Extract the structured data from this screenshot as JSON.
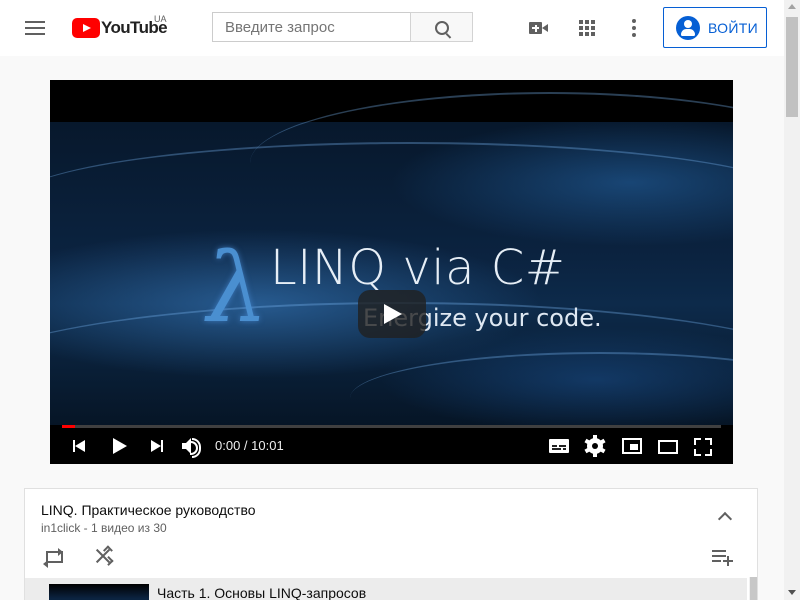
{
  "header": {
    "logo_text": "YouTube",
    "country": "UA",
    "search_placeholder": "Введите запрос",
    "login_label": "ВОЙТИ"
  },
  "player": {
    "video_title": "LINQ via C#",
    "video_subtitle": "Energize your code.",
    "time": "0:00 / 10:01",
    "progress": 0.02,
    "progress_color": "#ff0000"
  },
  "playlist": {
    "title": "LINQ. Практическое руководство",
    "meta": "in1click - 1 видео из 30",
    "items": [
      {
        "title": "Часть 1. Основы LINQ-запросов"
      }
    ]
  },
  "colors": {
    "brand": "#ff0000",
    "accent": "#065fd4"
  },
  "icons": [
    "menu-icon",
    "search-icon",
    "create-video-icon",
    "apps-icon",
    "more-icon",
    "account-icon",
    "play-icon",
    "previous-icon",
    "next-icon",
    "volume-icon",
    "subtitles-icon",
    "settings-icon",
    "miniplayer-icon",
    "theater-icon",
    "fullscreen-icon",
    "collapse-icon",
    "loop-icon",
    "shuffle-icon",
    "save-playlist-icon"
  ]
}
